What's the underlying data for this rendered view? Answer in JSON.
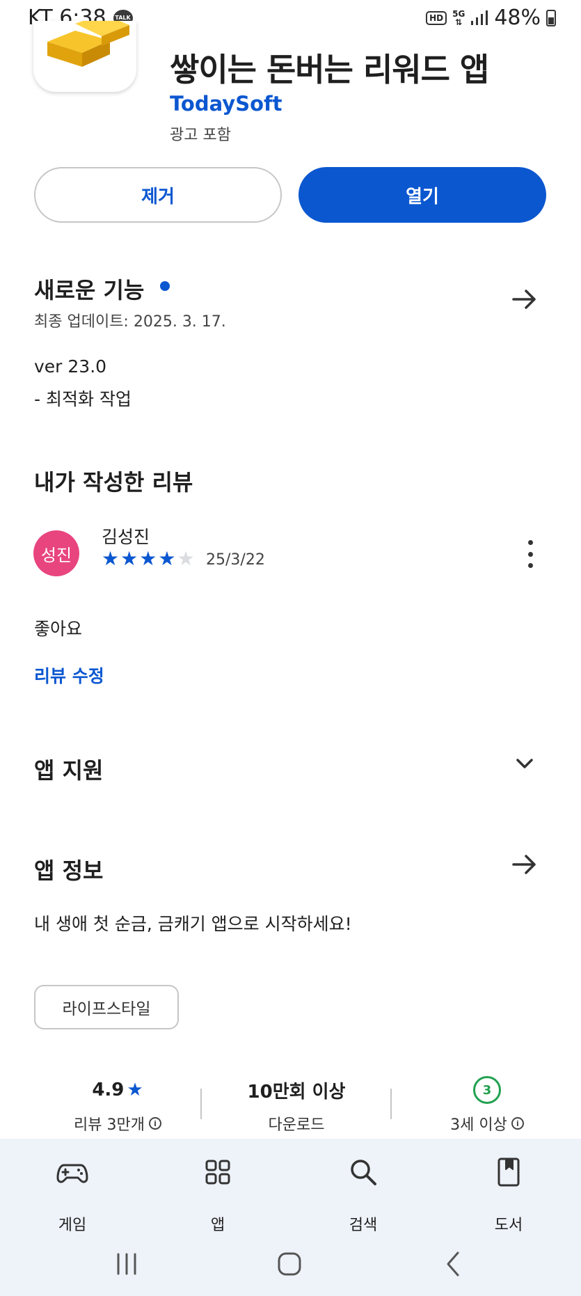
{
  "status_bar": {
    "carrier_time": "KT 6:38",
    "talk_badge": "TALK",
    "hd_badge": "HD",
    "network": "5G",
    "battery": "48%"
  },
  "app": {
    "title": "쌓이는 돈버는 리워드 앱",
    "developer": "TodaySoft",
    "ads_note": "광고 포함",
    "icon": "gold-bars-icon"
  },
  "actions": {
    "uninstall_label": "제거",
    "open_label": "열기"
  },
  "whats_new": {
    "title": "새로운 기능",
    "updated": "최종 업데이트: 2025. 3. 17.",
    "version": "ver 23.0",
    "note": "- 최적화 작업"
  },
  "my_review": {
    "title": "내가 작성한 리뷰",
    "avatar_text": "성진",
    "reviewer": "김성진",
    "rating": 4,
    "max_rating": 5,
    "date": "25/3/22",
    "text": "좋아요",
    "edit_label": "리뷰 수정"
  },
  "app_support": {
    "title": "앱 지원"
  },
  "app_info": {
    "title": "앱 정보",
    "description": "내 생애 첫 순금, 금캐기 앱으로 시작하세요!",
    "category": "라이프스타일"
  },
  "stats": {
    "rating_value": "4.9",
    "rating_label": "리뷰 3만개",
    "downloads_value": "10만회 이상",
    "downloads_label": "다운로드",
    "age_value": "3",
    "age_label": "3세 이상"
  },
  "bottom_nav": {
    "items": [
      {
        "label": "게임",
        "icon": "gamepad-icon"
      },
      {
        "label": "앱",
        "icon": "apps-grid-icon"
      },
      {
        "label": "검색",
        "icon": "search-icon"
      },
      {
        "label": "도서",
        "icon": "book-icon"
      }
    ]
  },
  "colors": {
    "accent": "#0b57d0",
    "avatar": "#e8457f",
    "age_badge": "#21a150",
    "nav_bg": "#eef2f9"
  }
}
